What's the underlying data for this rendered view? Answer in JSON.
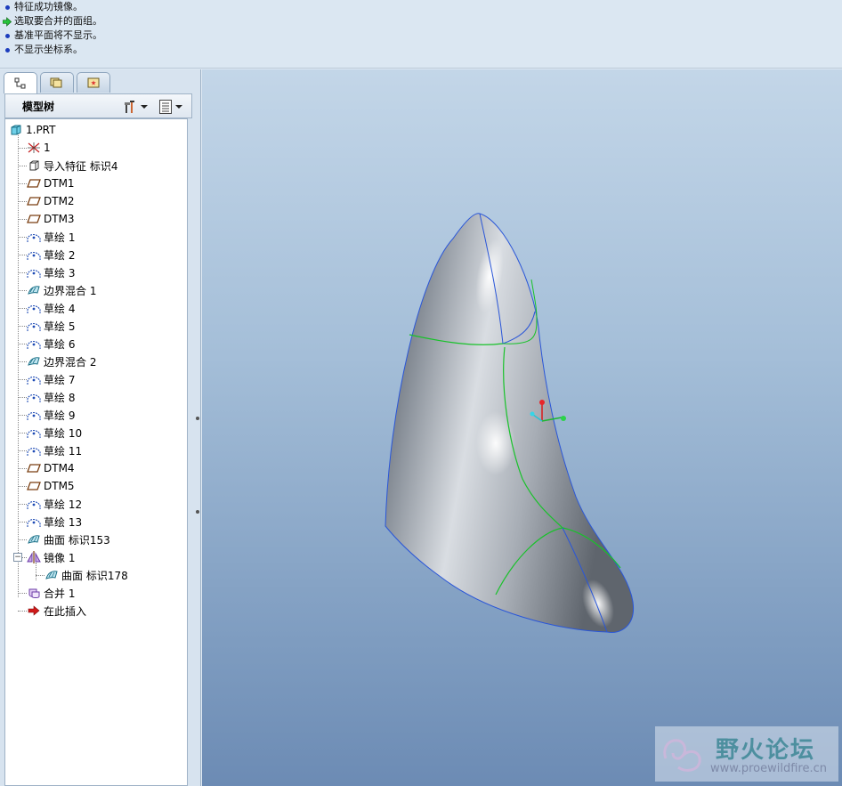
{
  "messages": [
    {
      "icon": "info-bullet-icon",
      "text": "特征成功镜像。"
    },
    {
      "icon": "prompt-arrow-icon",
      "text": "选取要合并的面组。"
    },
    {
      "icon": "info-bullet-icon",
      "text": "基准平面将不显示。"
    },
    {
      "icon": "info-bullet-icon",
      "text": "不显示坐标系。"
    }
  ],
  "panel": {
    "tabs": [
      "model-tree-tab",
      "folder-browser-tab",
      "favorites-tab"
    ],
    "header_title": "模型树",
    "settings_icon": "tree-settings-icon",
    "columns_icon": "tree-columns-icon"
  },
  "tree": {
    "root": "1.PRT",
    "items": [
      {
        "label": "1",
        "icon": "csys-icon"
      },
      {
        "label": "导入特征 标识4",
        "icon": "import-feature-icon"
      },
      {
        "label": "DTM1",
        "icon": "datum-plane-icon"
      },
      {
        "label": "DTM2",
        "icon": "datum-plane-icon"
      },
      {
        "label": "DTM3",
        "icon": "datum-plane-icon"
      },
      {
        "label": "草绘 1",
        "icon": "sketch-icon"
      },
      {
        "label": "草绘 2",
        "icon": "sketch-icon"
      },
      {
        "label": "草绘 3",
        "icon": "sketch-icon"
      },
      {
        "label": "边界混合 1",
        "icon": "boundary-blend-icon"
      },
      {
        "label": "草绘 4",
        "icon": "sketch-icon"
      },
      {
        "label": "草绘 5",
        "icon": "sketch-icon"
      },
      {
        "label": "草绘 6",
        "icon": "sketch-icon"
      },
      {
        "label": "边界混合 2",
        "icon": "boundary-blend-icon"
      },
      {
        "label": "草绘 7",
        "icon": "sketch-icon"
      },
      {
        "label": "草绘 8",
        "icon": "sketch-icon"
      },
      {
        "label": "草绘 9",
        "icon": "sketch-icon"
      },
      {
        "label": "草绘 10",
        "icon": "sketch-icon"
      },
      {
        "label": "草绘 11",
        "icon": "sketch-icon"
      },
      {
        "label": "DTM4",
        "icon": "datum-plane-icon"
      },
      {
        "label": "DTM5",
        "icon": "datum-plane-icon"
      },
      {
        "label": "草绘 12",
        "icon": "sketch-icon"
      },
      {
        "label": "草绘 13",
        "icon": "sketch-icon"
      },
      {
        "label": "曲面 标识153",
        "icon": "surface-icon"
      },
      {
        "label": "镜像 1",
        "icon": "mirror-icon",
        "expanded": true
      },
      {
        "label": "曲面 标识178",
        "icon": "surface-icon"
      },
      {
        "label": "合并 1",
        "icon": "merge-icon"
      },
      {
        "label": "在此插入",
        "icon": "insert-here-arrow-icon"
      }
    ]
  },
  "watermark": {
    "title": "野火论坛",
    "url": "www.proewildfire.cn"
  },
  "colors": {
    "viewport_top": "#c3d6e8",
    "viewport_bottom": "#6c8bb4",
    "surface_edge": "#2a56d8",
    "surface_green": "#18c22a"
  }
}
